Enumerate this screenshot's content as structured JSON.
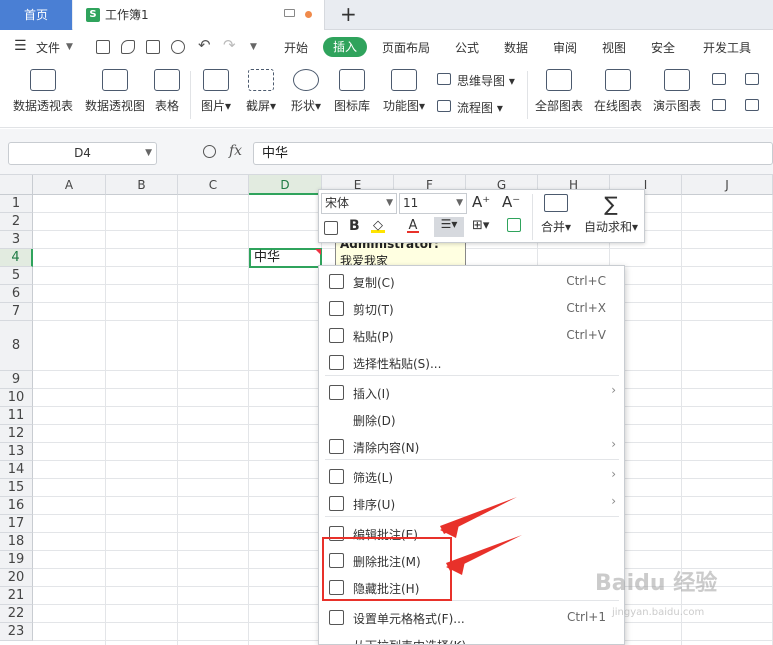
{
  "tabs": {
    "home": "首页",
    "workbook": "工作簿1",
    "workbook_icon": "S"
  },
  "menu": {
    "file": "文件",
    "items": [
      "开始",
      "插入",
      "页面布局",
      "公式",
      "数据",
      "审阅",
      "视图",
      "安全",
      "开发工具"
    ],
    "active": "插入"
  },
  "ribbon": {
    "pivot_table": "数据透视表",
    "pivot_chart": "数据透视图",
    "table": "表格",
    "picture": "图片",
    "screenshot": "截屏",
    "shape": "形状",
    "icon_library": "图标库",
    "function_chart": "功能图",
    "mind_map": "思维导图",
    "flowchart": "流程图",
    "all_charts": "全部图表",
    "online_charts": "在线图表",
    "demo_charts": "演示图表"
  },
  "formula_bar": {
    "name_box": "D4",
    "fx": "fx",
    "value": "中华"
  },
  "grid": {
    "columns": [
      "A",
      "B",
      "C",
      "D",
      "E",
      "F",
      "G",
      "H",
      "I",
      "J"
    ],
    "rows": [
      "1",
      "2",
      "3",
      "4",
      "5",
      "6",
      "7",
      "8",
      "9",
      "10",
      "11",
      "12",
      "13",
      "14",
      "15",
      "16",
      "17",
      "18",
      "19",
      "20",
      "21",
      "22",
      "23"
    ],
    "selected_col": "D",
    "selected_row": "4",
    "cell_d4": "中华"
  },
  "comment": {
    "author": "Administrator:",
    "text": "我爱我家"
  },
  "mini_toolbar": {
    "font": "宋体",
    "size": "11",
    "merge": "合并",
    "autosum": "自动求和"
  },
  "context_menu": [
    {
      "label": "复制(C)",
      "shortcut": "Ctrl+C",
      "icon": "copy-icon"
    },
    {
      "label": "剪切(T)",
      "shortcut": "Ctrl+X",
      "icon": "scissors-icon"
    },
    {
      "label": "粘贴(P)",
      "shortcut": "Ctrl+V",
      "icon": "paste-icon"
    },
    {
      "label": "选择性粘贴(S)...",
      "shortcut": "",
      "icon": "paste-special-icon"
    },
    {
      "label": "插入(I)",
      "shortcut": "",
      "icon": "insert-icon"
    },
    {
      "label": "删除(D)",
      "shortcut": "",
      "icon": ""
    },
    {
      "label": "清除内容(N)",
      "shortcut": "",
      "icon": "eraser-icon"
    },
    {
      "label": "筛选(L)",
      "shortcut": "",
      "icon": "filter-icon"
    },
    {
      "label": "排序(U)",
      "shortcut": "",
      "icon": "sort-icon"
    },
    {
      "label": "编辑批注(E)...",
      "shortcut": "",
      "icon": "edit-comment-icon"
    },
    {
      "label": "删除批注(M)",
      "shortcut": "",
      "icon": "delete-comment-icon"
    },
    {
      "label": "隐藏批注(H)",
      "shortcut": "",
      "icon": "hide-comment-icon"
    },
    {
      "label": "设置单元格格式(F)...",
      "shortcut": "Ctrl+1",
      "icon": "format-cells-icon"
    },
    {
      "label": "从下拉列表中选择(K)...",
      "shortcut": "",
      "icon": ""
    }
  ],
  "watermark": {
    "main": "Baidu 经验",
    "sub": "jingyan.baidu.com"
  },
  "colors": {
    "accent_green": "#2fa35c",
    "home_tab_blue": "#4a7fd4",
    "annotation_red": "#e8312a"
  }
}
